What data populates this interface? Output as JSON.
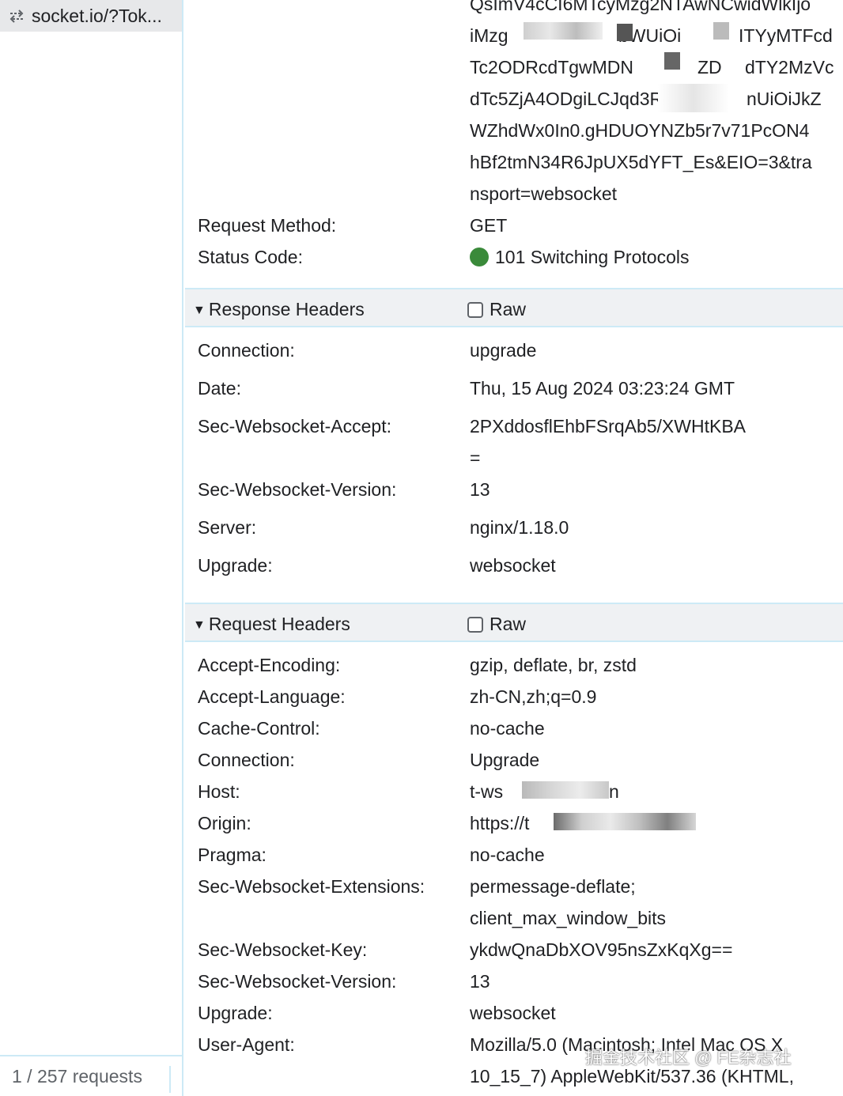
{
  "sidebar": {
    "request_name": "socket.io/?Tok...",
    "request_icon": "websocket-arrows-icon",
    "footer_count": "1 / 257 requests"
  },
  "general": {
    "url_lines": [
      "QsImV4cCI6MTcyMzg2NTAwNCwidWlkIjo",
      "iMzg",
      "Tc2ODRcdTgwMDN",
      "dTc5ZjA4ODgiLCJqd3Rfc",
      "WZhdWx0In0.gHDUOYNZb5r7v71PcON4",
      "hBf2tmN34R6JpUX5dYFT_Es&EIO=3&tra",
      "nsport=websocket"
    ],
    "url_fragments": {
      "line2_right": "bWUiOi",
      "line2_far": "ITYyMTFcd",
      "line3_mid": "ZD",
      "line3_far": "dTY2MzVc",
      "line4_far": "nUiOiJkZ"
    },
    "fields": [
      {
        "key": "Request Method:",
        "value": "GET"
      },
      {
        "key": "Status Code:",
        "value": "101 Switching Protocols"
      }
    ],
    "status_color": "#3a8a3a"
  },
  "response_headers": {
    "title": "Response Headers",
    "raw_label": "Raw",
    "fields": [
      {
        "key": "Connection:",
        "value": "upgrade"
      },
      {
        "key": "Date:",
        "value": "Thu, 15 Aug 2024 03:23:24 GMT"
      },
      {
        "key": "Sec-Websocket-Accept:",
        "value": "2PXddosflEhbFSrqAb5/XWHtKBA",
        "value2": "="
      },
      {
        "key": "Sec-Websocket-Version:",
        "value": "13"
      },
      {
        "key": "Server:",
        "value": "nginx/1.18.0"
      },
      {
        "key": "Upgrade:",
        "value": "websocket"
      }
    ]
  },
  "request_headers": {
    "title": "Request Headers",
    "raw_label": "Raw",
    "fields": [
      {
        "key": "Accept-Encoding:",
        "value": "gzip, deflate, br, zstd"
      },
      {
        "key": "Accept-Language:",
        "value": "zh-CN,zh;q=0.9"
      },
      {
        "key": "Cache-Control:",
        "value": "no-cache"
      },
      {
        "key": "Connection:",
        "value": "Upgrade"
      },
      {
        "key": "Host:",
        "value": "t-ws",
        "value_tail": "n"
      },
      {
        "key": "Origin:",
        "value": "https://t"
      },
      {
        "key": "Pragma:",
        "value": "no-cache"
      },
      {
        "key": "Sec-Websocket-Extensions:",
        "value": "permessage-deflate;",
        "value2": "client_max_window_bits"
      },
      {
        "key": "Sec-Websocket-Key:",
        "value": "ykdwQnaDbXOV95nsZxKqXg=="
      },
      {
        "key": "Sec-Websocket-Version:",
        "value": "13"
      },
      {
        "key": "Upgrade:",
        "value": "websocket"
      },
      {
        "key": "User-Agent:",
        "value": "Mozilla/5.0 (Macintosh; Intel Mac OS X",
        "value2": "10_15_7) AppleWebKit/537.36 (KHTML,"
      }
    ]
  },
  "watermark": "掘金技术社区 @ FE杂志社",
  "colors": {
    "accent_border": "#cdeaf6",
    "section_bg": "#eff1f3",
    "selected_row_bg": "#e7e8ea"
  }
}
